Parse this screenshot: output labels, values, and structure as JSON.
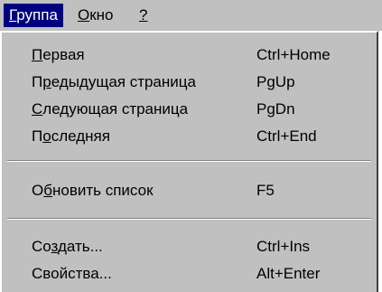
{
  "menubar": {
    "items": [
      {
        "pre": "",
        "key": "Г",
        "post": "руппа"
      },
      {
        "pre": "",
        "key": "О",
        "post": "кно"
      },
      {
        "pre": "",
        "key": "?",
        "post": ""
      }
    ]
  },
  "menu": {
    "items": [
      {
        "pre": "",
        "key": "П",
        "post": "ервая",
        "shortcut": "Ctrl+Home"
      },
      {
        "pre": "П",
        "key": "р",
        "post": "едыдущая страница",
        "shortcut": "PgUp"
      },
      {
        "pre": "",
        "key": "С",
        "post": "ледующая страница",
        "shortcut": "PgDn"
      },
      {
        "pre": "П",
        "key": "о",
        "post": "следняя",
        "shortcut": "Ctrl+End"
      },
      {
        "pre": "О",
        "key": "б",
        "post": "новить список",
        "shortcut": "F5"
      },
      {
        "pre": "Со",
        "key": "з",
        "post": "дать...",
        "shortcut": "Ctrl+Ins"
      },
      {
        "pre": "Свойства...",
        "key": "",
        "post": "",
        "shortcut": "Alt+Enter"
      }
    ]
  },
  "colors": {
    "menu_bg": "#c0c0c0",
    "highlight_bg": "#000080",
    "highlight_text": "#ffffff"
  }
}
